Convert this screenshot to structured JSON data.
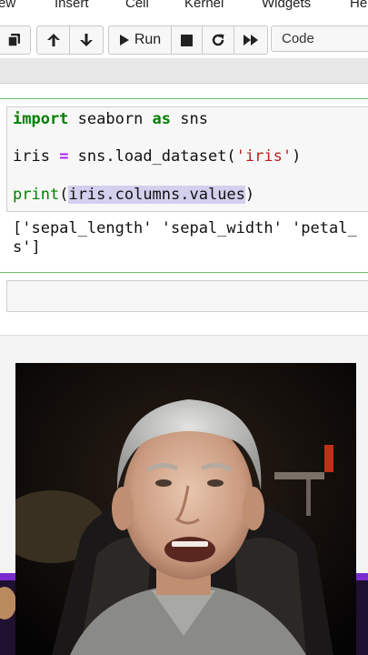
{
  "menubar": {
    "items": [
      "ew",
      "Insert",
      "Cell",
      "Kernel",
      "Widgets",
      "He"
    ]
  },
  "toolbar": {
    "run_label": "Run",
    "cell_type": "Code",
    "icons": [
      "copy-icon",
      "arrow-up-icon",
      "arrow-down-icon",
      "play-icon",
      "stop-icon",
      "restart-icon",
      "fast-forward-icon"
    ]
  },
  "cell": {
    "code_lines": {
      "l1": {
        "kw": "import",
        "mid": " seaborn ",
        "kw2": "as",
        "end": " sns"
      },
      "l2": {
        "a": "iris ",
        "op": "=",
        "b": " sns.load_dataset(",
        "str": "'iris'",
        "c": ")"
      },
      "l3": {
        "fn": "print",
        "open": "(",
        "sel": "iris.columns.values",
        "close": ")"
      }
    },
    "output_lines": [
      "['sepal_length' 'sepal_width' 'petal_",
      "s']"
    ]
  },
  "colors": {
    "keyword": "#008000",
    "operator": "#aa22ff",
    "string": "#ba2121",
    "selected_cell_border": "#66bb6a",
    "selection": "#d3d0ee",
    "overlay_bar": "#7a2ccf"
  }
}
